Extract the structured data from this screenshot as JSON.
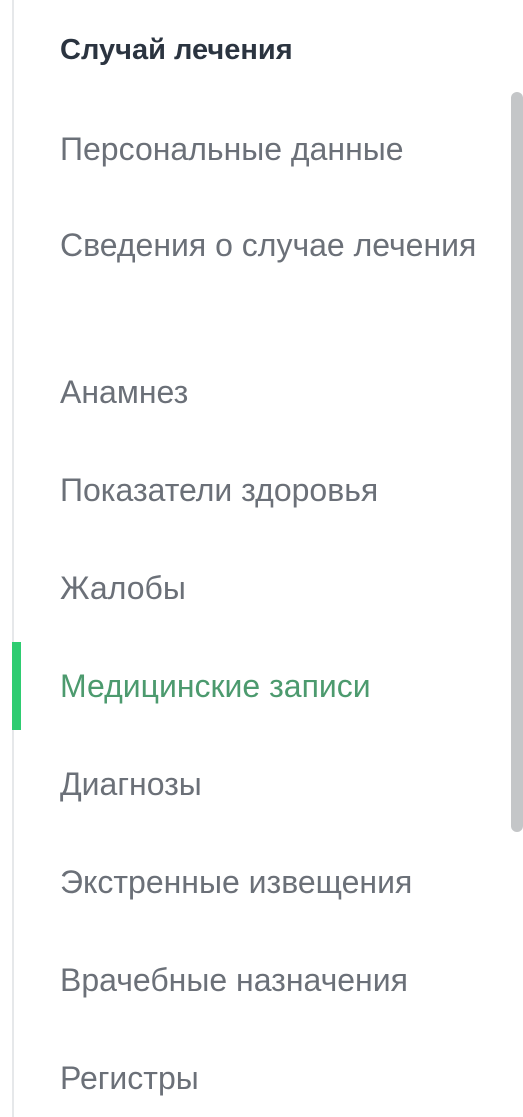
{
  "panel": {
    "title": "Случай лечения",
    "items": [
      {
        "label": "Персональные данные",
        "active": false
      },
      {
        "label": "Сведения о случае лечения",
        "active": false
      },
      {
        "label": "Анамнез",
        "active": false
      },
      {
        "label": "Показатели здоровья",
        "active": false
      },
      {
        "label": "Жалобы",
        "active": false
      },
      {
        "label": "Медицинские записи",
        "active": true
      },
      {
        "label": "Диагнозы",
        "active": false
      },
      {
        "label": "Экстренные извещения",
        "active": false
      },
      {
        "label": "Врачебные назначения",
        "active": false
      },
      {
        "label": "Регистры",
        "active": false
      }
    ]
  },
  "colors": {
    "active_text": "#4c9a6e",
    "active_indicator": "#2ecc71",
    "item_text": "#6b7078",
    "title_text": "#2b3440"
  }
}
